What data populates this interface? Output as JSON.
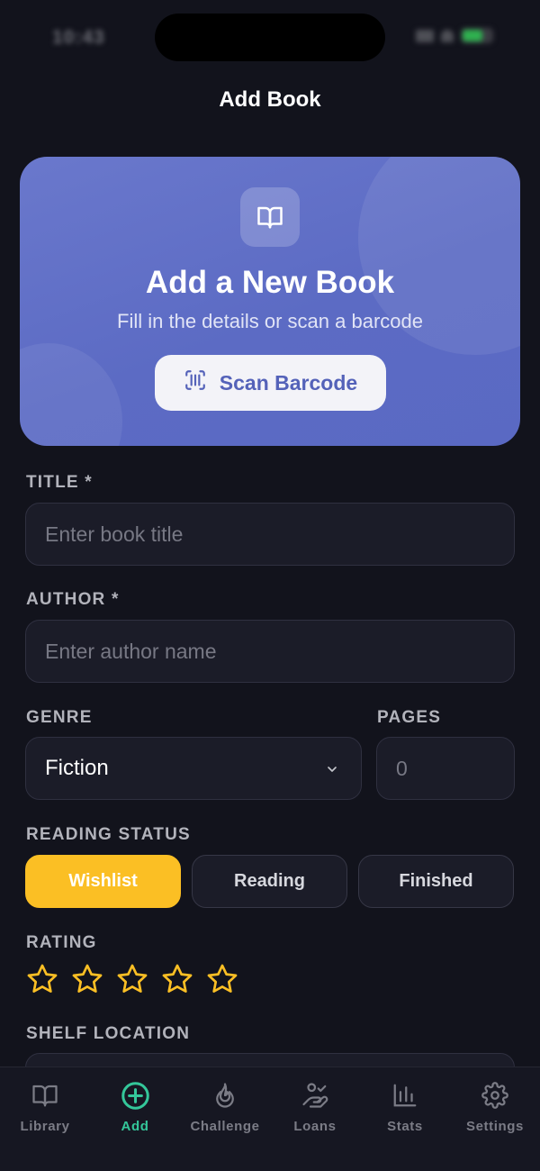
{
  "status_bar": {
    "time": "10:43"
  },
  "nav": {
    "title": "Add Book"
  },
  "hero": {
    "title": "Add a New Book",
    "subtitle": "Fill in the details or scan a barcode",
    "scan_label": "Scan Barcode",
    "icon": "book-open-icon"
  },
  "form": {
    "title_label": "TITLE *",
    "title_placeholder": "Enter book title",
    "author_label": "AUTHOR *",
    "author_placeholder": "Enter author name",
    "genre_label": "GENRE",
    "genre_value": "Fiction",
    "pages_label": "PAGES",
    "pages_placeholder": "0",
    "reading_status_label": "READING STATUS",
    "reading_status": [
      {
        "label": "Wishlist",
        "active": true
      },
      {
        "label": "Reading",
        "active": false
      },
      {
        "label": "Finished",
        "active": false
      }
    ],
    "rating_label": "RATING",
    "rating_value": 0,
    "rating_max": 5,
    "shelf_label": "SHELF LOCATION"
  },
  "tabs": [
    {
      "label": "Library",
      "icon": "book-icon",
      "active": false
    },
    {
      "label": "Add",
      "icon": "plus-circle-icon",
      "active": true
    },
    {
      "label": "Challenge",
      "icon": "flame-icon",
      "active": false
    },
    {
      "label": "Loans",
      "icon": "hand-heart-icon",
      "active": false
    },
    {
      "label": "Stats",
      "icon": "bar-chart-icon",
      "active": false
    },
    {
      "label": "Settings",
      "icon": "gear-icon",
      "active": false
    }
  ],
  "colors": {
    "background": "#12131c",
    "hero": "#5c6bc4",
    "accent_yellow": "#fbbf24",
    "accent_green": "#34c79a",
    "field_bg": "#1b1c28"
  }
}
